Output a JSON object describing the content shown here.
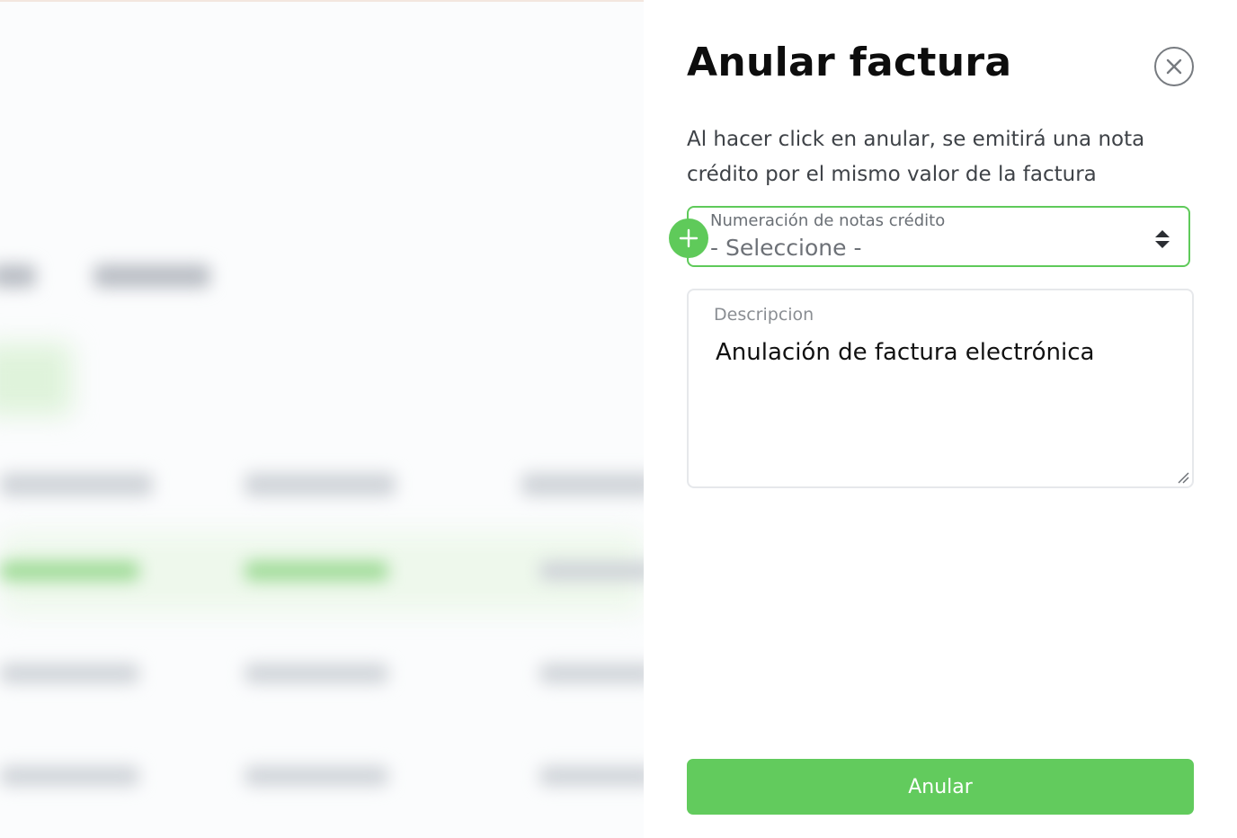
{
  "dialog": {
    "title": "Anular factura",
    "description": "Al hacer click en anular, se emitirá una nota crédito por el mismo valor de la factura",
    "close_icon": "close-circle-icon",
    "numbering_select": {
      "label": "Numeración de notas crédito",
      "value": "- Seleccione -",
      "add_icon": "plus-icon",
      "sort_icon": "sort-arrows-icon"
    },
    "description_field": {
      "label": "Descripcion",
      "value": "Anulación de factura electrónica"
    },
    "submit_label": "Anular"
  },
  "colors": {
    "accent": "#62cb5d",
    "title": "#0d0d0d",
    "text": "#3e4247"
  }
}
